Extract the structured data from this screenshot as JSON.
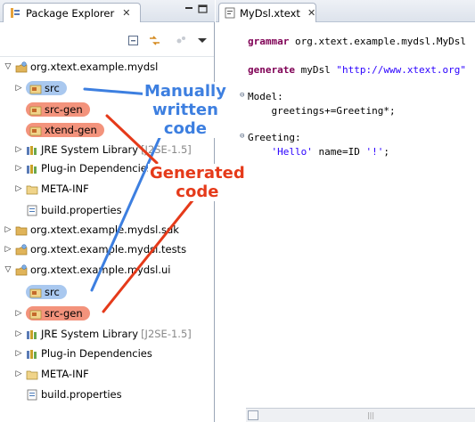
{
  "left_view": {
    "tab_title": "Package Explorer",
    "tab_close": "✕",
    "minimize": "▭",
    "maximize": "□"
  },
  "tree": [
    {
      "label": "org.xtext.example.mydsl"
    },
    {
      "label": "src"
    },
    {
      "label": "src-gen"
    },
    {
      "label": "xtend-gen"
    },
    {
      "label": "JRE System Library",
      "suffix": "[J2SE-1.5]"
    },
    {
      "label": "Plug-in Dependencies"
    },
    {
      "label": "META-INF"
    },
    {
      "label": "build.properties"
    },
    {
      "label": "org.xtext.example.mydsl.sdk"
    },
    {
      "label": "org.xtext.example.mydsl.tests"
    },
    {
      "label": "org.xtext.example.mydsl.ui"
    },
    {
      "label": "src"
    },
    {
      "label": "src-gen"
    },
    {
      "label": "JRE System Library",
      "suffix": "[J2SE-1.5]"
    },
    {
      "label": "Plug-in Dependencies"
    },
    {
      "label": "META-INF"
    },
    {
      "label": "build.properties"
    }
  ],
  "editor": {
    "tab_title": "MyDsl.xtext",
    "tab_close": "✕",
    "lines": {
      "l1_kw": "grammar",
      "l1_rest": " org.xtext.example.mydsl.MyDsl",
      "l2_kw": "generate",
      "l2_mid": " myDsl ",
      "l2_str": "\"http://www.xtext.org\"",
      "l3": "Model:",
      "l4": "    greetings+=Greeting*;",
      "l5": "Greeting:",
      "l6_pre": "    ",
      "l6_str1": "'Hello'",
      "l6_mid": " name=ID ",
      "l6_str2": "'!'",
      "l6_end": ";"
    },
    "scroll_thumb": "|||"
  },
  "annotations": {
    "manual": [
      "Manually",
      "written",
      "code"
    ],
    "generated": [
      "Generated",
      "code"
    ]
  },
  "colors": {
    "manual": "#3d7fe0",
    "generated": "#e53a1a",
    "keyword": "#7f0055",
    "string": "#2a00ff"
  }
}
